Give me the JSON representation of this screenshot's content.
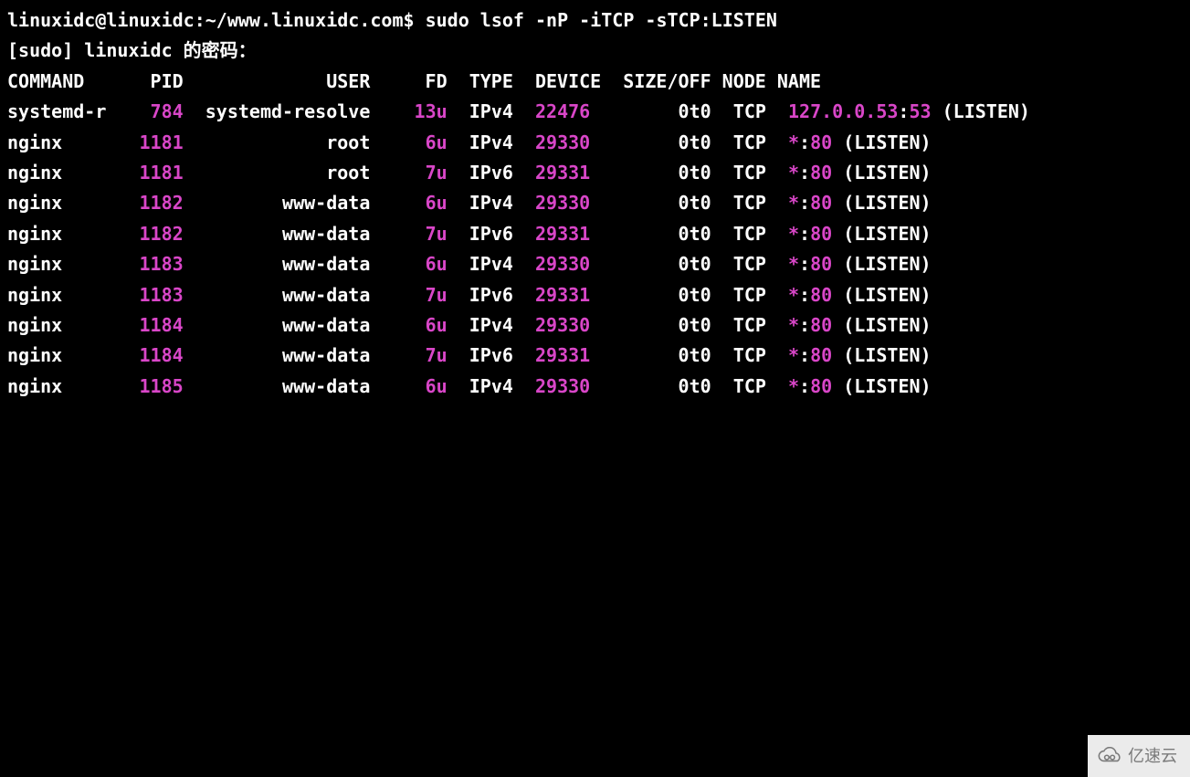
{
  "prompt": {
    "userhost": "linuxidc@linuxidc",
    "path": "~/www.linuxidc.com",
    "symbol": "$",
    "command": "sudo lsof -nP -iTCP -sTCP:LISTEN"
  },
  "sudo_line": "[sudo] linuxidc 的密码：",
  "headers": {
    "command": "COMMAND",
    "pid": "PID",
    "user": "USER",
    "fd": "FD",
    "type": "TYPE",
    "device": "DEVICE",
    "sizeoff": "SIZE/OFF",
    "node": "NODE",
    "name": "NAME"
  },
  "rows": [
    {
      "command": "systemd-r",
      "pid": "784",
      "user": "systemd-resolve",
      "fd": "13u",
      "type": "IPv4",
      "device": "22476",
      "sizeoff": "0t0",
      "node": "TCP",
      "host": "127.0.0.53",
      "port": "53",
      "listen": "(LISTEN)"
    },
    {
      "command": "nginx",
      "pid": "1181",
      "user": "root",
      "fd": "6u",
      "type": "IPv4",
      "device": "29330",
      "sizeoff": "0t0",
      "node": "TCP",
      "host": "*",
      "port": "80",
      "listen": "(LISTEN)"
    },
    {
      "command": "nginx",
      "pid": "1181",
      "user": "root",
      "fd": "7u",
      "type": "IPv6",
      "device": "29331",
      "sizeoff": "0t0",
      "node": "TCP",
      "host": "*",
      "port": "80",
      "listen": "(LISTEN)"
    },
    {
      "command": "nginx",
      "pid": "1182",
      "user": "www-data",
      "fd": "6u",
      "type": "IPv4",
      "device": "29330",
      "sizeoff": "0t0",
      "node": "TCP",
      "host": "*",
      "port": "80",
      "listen": "(LISTEN)"
    },
    {
      "command": "nginx",
      "pid": "1182",
      "user": "www-data",
      "fd": "7u",
      "type": "IPv6",
      "device": "29331",
      "sizeoff": "0t0",
      "node": "TCP",
      "host": "*",
      "port": "80",
      "listen": "(LISTEN)"
    },
    {
      "command": "nginx",
      "pid": "1183",
      "user": "www-data",
      "fd": "6u",
      "type": "IPv4",
      "device": "29330",
      "sizeoff": "0t0",
      "node": "TCP",
      "host": "*",
      "port": "80",
      "listen": "(LISTEN)"
    },
    {
      "command": "nginx",
      "pid": "1183",
      "user": "www-data",
      "fd": "7u",
      "type": "IPv6",
      "device": "29331",
      "sizeoff": "0t0",
      "node": "TCP",
      "host": "*",
      "port": "80",
      "listen": "(LISTEN)"
    },
    {
      "command": "nginx",
      "pid": "1184",
      "user": "www-data",
      "fd": "6u",
      "type": "IPv4",
      "device": "29330",
      "sizeoff": "0t0",
      "node": "TCP",
      "host": "*",
      "port": "80",
      "listen": "(LISTEN)"
    },
    {
      "command": "nginx",
      "pid": "1184",
      "user": "www-data",
      "fd": "7u",
      "type": "IPv6",
      "device": "29331",
      "sizeoff": "0t0",
      "node": "TCP",
      "host": "*",
      "port": "80",
      "listen": "(LISTEN)"
    },
    {
      "command": "nginx",
      "pid": "1185",
      "user": "www-data",
      "fd": "6u",
      "type": "IPv4",
      "device": "29330",
      "sizeoff": "0t0",
      "node": "TCP",
      "host": "*",
      "port": "80",
      "listen": "(LISTEN)"
    }
  ],
  "watermark": "亿速云",
  "colors": {
    "magenta": "#d946c8",
    "background": "#000000",
    "foreground": "#ffffff"
  }
}
